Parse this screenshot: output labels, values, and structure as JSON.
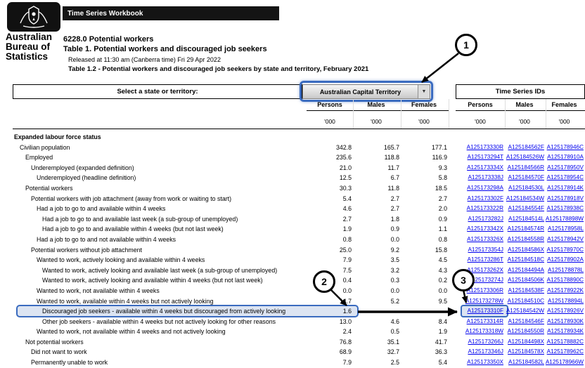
{
  "header": {
    "banner": "Time Series Workbook",
    "logo": [
      "Australian",
      "Bureau of",
      "Statistics"
    ],
    "catalogue_title": "6228.0 Potential workers",
    "table_title": "Table 1. Potential workers and discouraged job seekers",
    "released": "Released at 11:30 am (Canberra time) Fri 29 Apr 2022",
    "subtitle": "Table 1.2 - Potential workers and discouraged job seekers by state and territory, February 2021"
  },
  "selector": {
    "label": "Select a state or territory:",
    "value": "Australian Capital Territory",
    "dropdown_icon": "▼"
  },
  "table": {
    "group_header": "Time Series IDs",
    "columns": [
      "Persons",
      "Males",
      "Females"
    ],
    "ts_columns": [
      "Persons",
      "Males",
      "Females"
    ],
    "units": "'000",
    "rows": [
      {
        "label": "Expanded labour force status",
        "type": "section",
        "indent": 0,
        "values": [
          "",
          "",
          ""
        ],
        "ids": [
          "",
          "",
          ""
        ]
      },
      {
        "label": "Civilian population",
        "indent": 1,
        "values": [
          "342.8",
          "165.7",
          "177.1"
        ],
        "ids": [
          "A125173330R",
          "A125184562F",
          "A125178946C"
        ]
      },
      {
        "label": "Employed",
        "indent": 2,
        "values": [
          "235.6",
          "118.8",
          "116.9"
        ],
        "ids": [
          "A125173294T",
          "A125184526W",
          "A125178910A"
        ]
      },
      {
        "label": "Underemployed (expanded definition)",
        "indent": 3,
        "values": [
          "21.0",
          "11.7",
          "9.3"
        ],
        "ids": [
          "A125173334X",
          "A125184566R",
          "A125178950V"
        ]
      },
      {
        "label": "Underemployed (headline definition)",
        "indent": 4,
        "values": [
          "12.5",
          "6.7",
          "5.8"
        ],
        "ids": [
          "A125173338J",
          "A125184570F",
          "A125178954C"
        ]
      },
      {
        "label": "Potential workers",
        "indent": 2,
        "values": [
          "30.3",
          "11.8",
          "18.5"
        ],
        "ids": [
          "A125173298A",
          "A125184530L",
          "A125178914K"
        ]
      },
      {
        "label": "Potential workers with job attachment (away from work or waiting to start)",
        "indent": 3,
        "values": [
          "5.4",
          "2.7",
          "2.7"
        ],
        "ids": [
          "A125173302F",
          "A125184534W",
          "A125178918V"
        ]
      },
      {
        "label": "Had a job to go to and available within 4 weeks",
        "indent": 4,
        "values": [
          "4.6",
          "2.7",
          "2.0"
        ],
        "ids": [
          "A125173322R",
          "A125184554F",
          "A125178938C"
        ]
      },
      {
        "label": "Had a job to go to and available last week (a sub-group of unemployed)",
        "indent": 5,
        "values": [
          "2.7",
          "1.8",
          "0.9"
        ],
        "ids": [
          "A125173282J",
          "A125184514L",
          "A125178898W"
        ]
      },
      {
        "label": "Had a job to go to and available within 4 weeks (but not last week)",
        "indent": 5,
        "values": [
          "1.9",
          "0.9",
          "1.1"
        ],
        "ids": [
          "A125173342X",
          "A125184574R",
          "A125178958L"
        ]
      },
      {
        "label": "Had a job to go to and not available within 4 weeks",
        "indent": 4,
        "values": [
          "0.8",
          "0.0",
          "0.8"
        ],
        "ids": [
          "A125173326X",
          "A125184558R",
          "A125178942V"
        ]
      },
      {
        "label": "Potential workers without job attachment",
        "indent": 3,
        "values": [
          "25.0",
          "9.2",
          "15.8"
        ],
        "ids": [
          "A125173354J",
          "A125184586X",
          "A125178970C"
        ]
      },
      {
        "label": "Wanted to work, actively looking and available within 4 weeks",
        "indent": 4,
        "values": [
          "7.9",
          "3.5",
          "4.5"
        ],
        "ids": [
          "A125173286T",
          "A125184518C",
          "A125178902A"
        ]
      },
      {
        "label": "Wanted to work, actively looking and available last week (a sub-group of unemployed)",
        "indent": 5,
        "values": [
          "7.5",
          "3.2",
          "4.3"
        ],
        "ids": [
          "A125173262X",
          "A125184494A",
          "A125178878L"
        ]
      },
      {
        "label": "Wanted to work, actively looking and available within 4 weeks (but not last week)",
        "indent": 5,
        "values": [
          "0.4",
          "0.3",
          "0.2"
        ],
        "ids": [
          "A125173274J",
          "A125184506K",
          "A125178890C"
        ]
      },
      {
        "label": "Wanted to work, not available within 4 weeks",
        "indent": 4,
        "values": [
          "0.0",
          "0.0",
          "0.0"
        ],
        "ids": [
          "A125173306R",
          "A125184538F",
          "A125178922K"
        ]
      },
      {
        "label": "Wanted to work, available within 4 weeks but not actively looking",
        "indent": 4,
        "values": [
          "14.7",
          "5.2",
          "9.5"
        ],
        "ids": [
          "A125173278W",
          "A125184510C",
          "A125178894L"
        ]
      },
      {
        "label": "Discouraged job seekers - available within 4 weeks but discouraged from actively looking",
        "indent": 5,
        "values": [
          "1.6",
          "",
          ""
        ],
        "ids": [
          "A125173310F",
          "A125184542W",
          "A125178926V"
        ],
        "highlighted": true
      },
      {
        "label": "Other job seekers - available within 4 weeks but not actively looking for other reasons",
        "indent": 5,
        "values": [
          "13.0",
          "4.6",
          "8.4"
        ],
        "ids": [
          "A125173314R",
          "A125184546F",
          "A125178930K"
        ]
      },
      {
        "label": "Wanted to work, not available within 4 weeks and not actively looking",
        "indent": 4,
        "values": [
          "2.4",
          "0.5",
          "1.9"
        ],
        "ids": [
          "A125173318W",
          "A125184550R",
          "A125178934K"
        ]
      },
      {
        "label": "Not potential workers",
        "indent": 2,
        "values": [
          "76.8",
          "35.1",
          "41.7"
        ],
        "ids": [
          "A125173266J",
          "A125184498X",
          "A125178882C"
        ]
      },
      {
        "label": "Did not want to work",
        "indent": 3,
        "values": [
          "68.9",
          "32.7",
          "36.3"
        ],
        "ids": [
          "A125173346J",
          "A125184578X",
          "A125178962C"
        ]
      },
      {
        "label": "Permanently unable to work",
        "indent": 3,
        "values": [
          "7.9",
          "2.5",
          "5.4"
        ],
        "ids": [
          "A125173350X",
          "A125184582L",
          "A125178966W"
        ]
      }
    ]
  },
  "callouts": [
    {
      "label": "1"
    },
    {
      "label": "2"
    },
    {
      "label": "3"
    }
  ],
  "colors": {
    "highlight_blue": "#3a6bbf",
    "link_blue": "#0000EE",
    "row_fill": "#dce4f2"
  }
}
